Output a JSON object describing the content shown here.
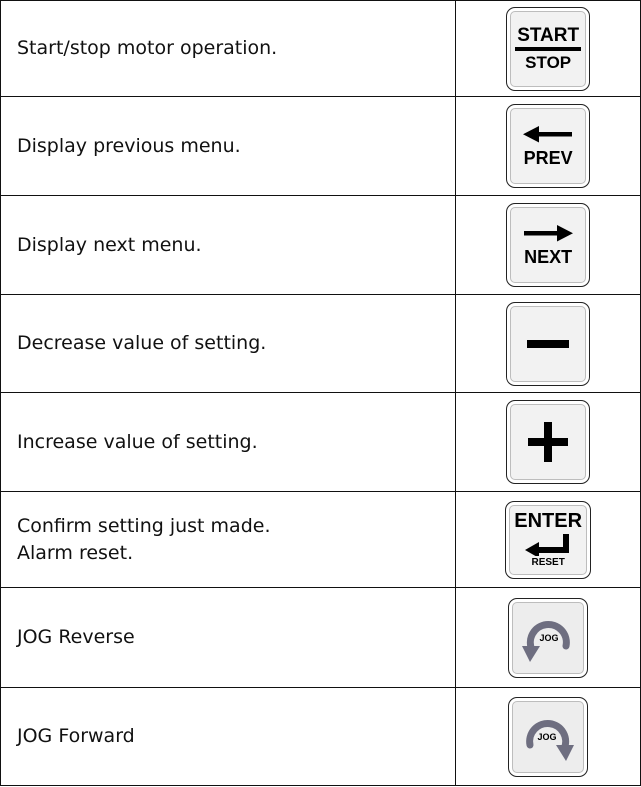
{
  "rows": [
    {
      "description": [
        "Start/stop motor operation."
      ],
      "key": {
        "icon": "start-stop-key",
        "label_top": "START",
        "label_bottom": "STOP"
      }
    },
    {
      "description": [
        "Display previous menu."
      ],
      "key": {
        "icon": "left-arrow-icon",
        "label": "PREV"
      }
    },
    {
      "description": [
        "Display next menu."
      ],
      "key": {
        "icon": "right-arrow-icon",
        "label": "NEXT"
      }
    },
    {
      "description": [
        "Decrease value of setting."
      ],
      "key": {
        "icon": "minus-icon"
      }
    },
    {
      "description": [
        "Increase value of setting."
      ],
      "key": {
        "icon": "plus-icon"
      }
    },
    {
      "description": [
        "Confirm setting just made.",
        "Alarm reset."
      ],
      "key": {
        "icon": "enter-arrow-icon",
        "label_top": "ENTER",
        "label_bottom": "RESET"
      }
    },
    {
      "description": [
        "JOG Reverse"
      ],
      "key": {
        "icon": "jog-reverse-icon",
        "label": "JOG"
      }
    },
    {
      "description": [
        "JOG Forward"
      ],
      "key": {
        "icon": "jog-forward-icon",
        "label": "JOG"
      }
    }
  ],
  "colors": {
    "border": "#111111",
    "key_face": "#f2f2f2",
    "jog_arrow": "#6e6e80"
  }
}
